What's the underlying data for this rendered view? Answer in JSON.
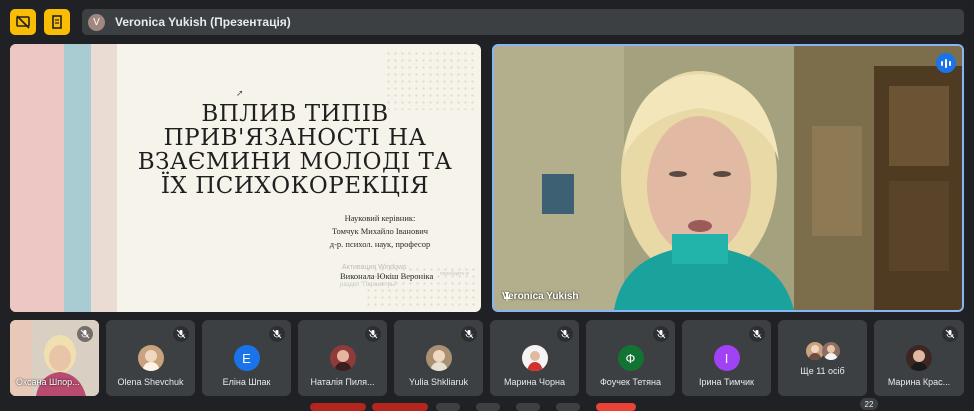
{
  "presentation": {
    "avatar_letter": "V",
    "title": "Veronica Yukish (Презентація)"
  },
  "slide": {
    "title_lines": [
      "ВПЛИВ ТИПІВ",
      "ПРИВ'ЯЗАНОСТІ НА",
      "ВЗАЄМИНИ МОЛОДІ ТА",
      "ЇХ ПСИХОКОРЕКЦІЯ"
    ],
    "supervisor_label": "Науковий керівник:",
    "supervisor_name": "Томчук Михайло Іванович",
    "supervisor_title": "д-р. психол. наук, професор",
    "watermark_top": "Активация Windows",
    "author": "Виконала Юкіш Вероніка",
    "watermark_side": "перейдите в",
    "watermark_bottom": "раздел \"Параметры\""
  },
  "camera": {
    "name": "Veronica Yukish"
  },
  "participants": [
    {
      "name": "Оксана Шпор...",
      "type": "photo"
    },
    {
      "name": "Olena Shevchuk",
      "type": "photo-avatar",
      "color": "#c9a27e"
    },
    {
      "name": "Еліна Шпак",
      "letter": "E",
      "color": "#1a73e8"
    },
    {
      "name": "Наталія Пиля...",
      "type": "photo-avatar",
      "color": "#8d3b3b"
    },
    {
      "name": "Yulia Shkliaruk",
      "type": "photo-avatar",
      "color": "#a89273"
    },
    {
      "name": "Марина Чорна",
      "type": "photo-avatar",
      "color": "#c62828"
    },
    {
      "name": "Фоучек Тетяна",
      "letter": "Ф",
      "color": "#137333"
    },
    {
      "name": "Ірина Тимчик",
      "letter": "І",
      "color": "#a142f4"
    },
    {
      "name": "Ще 11 осіб",
      "type": "more"
    },
    {
      "name": "Марина Крас...",
      "type": "photo-avatar",
      "color": "#3e2723"
    }
  ],
  "participant_count": "22",
  "colors": {
    "accent": "#fbbc04",
    "speaking": "#1a73e8",
    "highlight_border": "#8ab4f8"
  }
}
